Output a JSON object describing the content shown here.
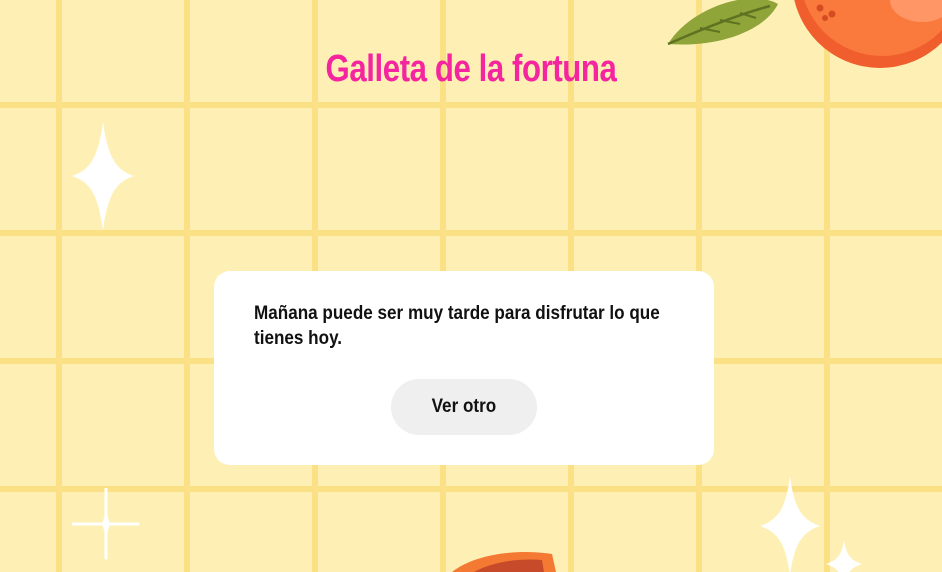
{
  "page": {
    "title": "Galleta de la fortuna"
  },
  "fortune": {
    "message": "Mañana puede ser muy tarde para disfrutar lo que tienes hoy.",
    "next_button_label": "Ver otro"
  },
  "colors": {
    "background": "#fef0b4",
    "grid_lines": "#fbe086",
    "title": "#f5249f",
    "card": "#ffffff",
    "button": "#efefef",
    "orange": "#f96f3a",
    "leaf": "#8fa53a"
  },
  "decorations": [
    "sparkle-icon",
    "orange-fruit-icon",
    "leaf-icon",
    "papaya-icon"
  ]
}
